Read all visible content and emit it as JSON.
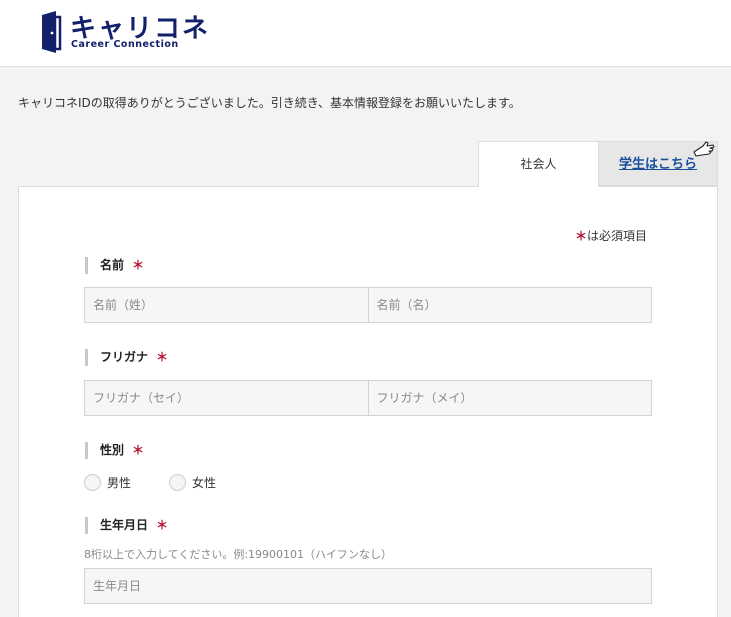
{
  "header": {
    "logo_name": "キャリコネ",
    "logo_subtitle": "Career Connection"
  },
  "intro_text": "キャリコネIDの取得ありがとうございました。引き続き、基本情報登録をお願いいたします。",
  "tabs": [
    {
      "label": "社会人",
      "active": true
    },
    {
      "label": "学生はこちら",
      "active": false
    }
  ],
  "required_note": {
    "mark": "＊",
    "text": "は必須項目"
  },
  "form": {
    "required_mark": "＊",
    "name": {
      "label": "名前",
      "last_placeholder": "名前（姓）",
      "first_placeholder": "名前（名）"
    },
    "furigana": {
      "label": "フリガナ",
      "last_placeholder": "フリガナ（セイ）",
      "first_placeholder": "フリガナ（メイ）"
    },
    "gender": {
      "label": "性別",
      "options": [
        "男性",
        "女性"
      ]
    },
    "birthdate": {
      "label": "生年月日",
      "hint": "8桁以上で入力してください。例:19900101（ハイフンなし）",
      "placeholder": "生年月日"
    }
  },
  "colors": {
    "brand_navy": "#13206b",
    "required_red": "#b3132f",
    "link_blue": "#1a4f9c"
  },
  "icons": {
    "logo_mark": "door-icon",
    "tab_pointer": "pointing-hand-icon"
  }
}
